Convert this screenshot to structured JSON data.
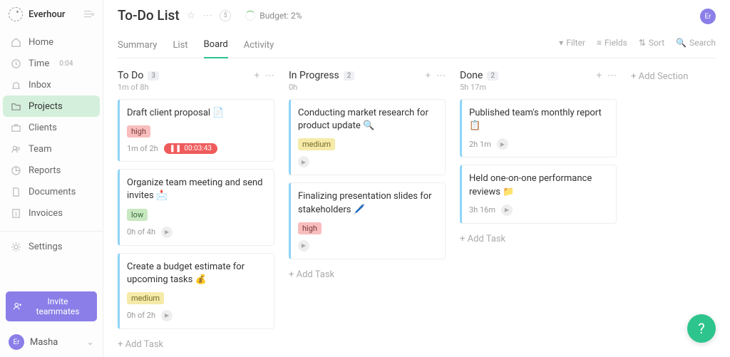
{
  "brand": "Everhour",
  "nav": {
    "home": "Home",
    "time": "Time",
    "time_badge": "0:04",
    "inbox": "Inbox",
    "projects": "Projects",
    "clients": "Clients",
    "team": "Team",
    "reports": "Reports",
    "documents": "Documents",
    "invoices": "Invoices",
    "settings": "Settings"
  },
  "invite_label": "Invite teammates",
  "user": {
    "initials": "Er",
    "name": "Masha"
  },
  "header_avatar": "Er",
  "page": {
    "title": "To-Do List",
    "budget_label": "Budget: 2%"
  },
  "tabs": {
    "summary": "Summary",
    "list": "List",
    "board": "Board",
    "activity": "Activity"
  },
  "toolbar": {
    "filter": "Filter",
    "fields": "Fields",
    "sort": "Sort",
    "search": "Search"
  },
  "columns": [
    {
      "title": "To Do",
      "count": "3",
      "sub": "1m of 8h",
      "cards": [
        {
          "title": "Draft client proposal 📄",
          "tag": "high",
          "tag_class": "high",
          "meta": "1m of 2h",
          "timer": "00:03:43"
        },
        {
          "title": "Organize team meeting and send invites 📩",
          "tag": "low",
          "tag_class": "low",
          "meta": "0h of 4h"
        },
        {
          "title": "Create a budget estimate for upcoming tasks 💰",
          "tag": "medium",
          "tag_class": "medium",
          "meta": "0h of 2h"
        }
      ]
    },
    {
      "title": "In Progress",
      "count": "2",
      "sub": "0h",
      "cards": [
        {
          "title": "Conducting market research for product update 🔍",
          "tag": "medium",
          "tag_class": "medium"
        },
        {
          "title": "Finalizing presentation slides for stakeholders 🖊️",
          "tag": "high",
          "tag_class": "high"
        }
      ]
    },
    {
      "title": "Done",
      "count": "2",
      "sub": "5h 17m",
      "cards": [
        {
          "title": "Published team's monthly report 📋",
          "meta": "2h 1m"
        },
        {
          "title": "Held one-on-one performance reviews 📁",
          "meta": "3h 16m"
        }
      ]
    }
  ],
  "add_task": "Add Task",
  "add_section": "Add Section"
}
